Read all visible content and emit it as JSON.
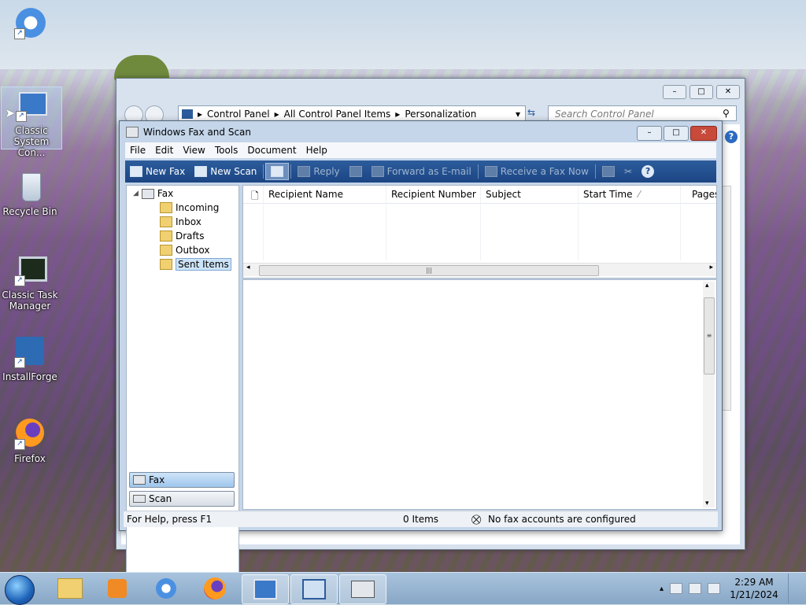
{
  "desktop": {
    "icons": [
      {
        "label": "",
        "icon": "chrome-like-icon"
      },
      {
        "label": "Classic System Con...",
        "icon": "system-config-icon"
      },
      {
        "label": "Recycle Bin",
        "icon": "recycle-bin-icon"
      },
      {
        "label": "Classic Task Manager",
        "icon": "task-manager-icon"
      },
      {
        "label": "InstallForge",
        "icon": "installforge-icon"
      },
      {
        "label": "Firefox",
        "icon": "firefox-icon"
      }
    ]
  },
  "control_panel": {
    "breadcrumb": [
      "Control Panel",
      "All Control Panel Items",
      "Personalization"
    ],
    "search_placeholder": "Search Control Panel"
  },
  "fax_window": {
    "title": "Windows Fax and Scan",
    "menu": [
      "File",
      "Edit",
      "View",
      "Tools",
      "Document",
      "Help"
    ],
    "toolbar": {
      "new_fax": "New Fax",
      "new_scan": "New Scan",
      "reply": "Reply",
      "forward": "Forward as E-mail",
      "receive": "Receive a Fax Now"
    },
    "tree": {
      "root": "Fax",
      "folders": [
        "Incoming",
        "Inbox",
        "Drafts",
        "Outbox",
        "Sent Items"
      ],
      "selected": "Sent Items"
    },
    "nav_buttons": [
      "Fax",
      "Scan"
    ],
    "columns": [
      "Recipient Name",
      "Recipient Number",
      "Subject",
      "Start Time",
      "Pages"
    ],
    "status": {
      "help": "For Help, press F1",
      "items": "0 Items",
      "accounts": "No fax accounts are configured"
    }
  },
  "taskbar": {
    "clock_time": "2:29 AM",
    "clock_date": "1/21/2024"
  }
}
